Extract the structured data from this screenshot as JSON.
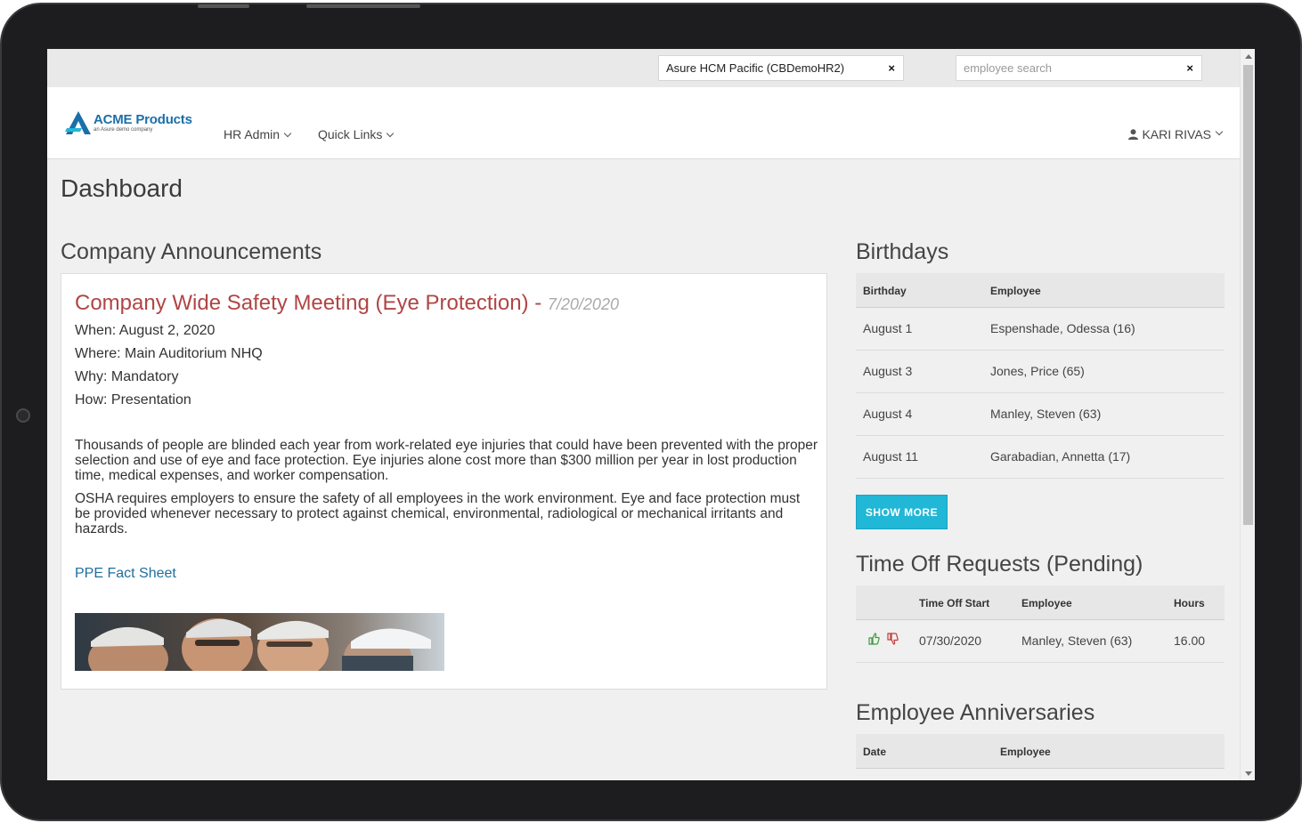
{
  "topbar": {
    "company_selector": "Asure HCM Pacific (CBDemoHR2)",
    "clear_symbol": "×",
    "search_placeholder": "employee search"
  },
  "navbar": {
    "logo_name": "ACME Products",
    "logo_sub": "an Asure demo company",
    "menu": [
      "HR Admin",
      "Quick Links"
    ],
    "user": "KARI RIVAS",
    "user_icon": "user-icon",
    "chevron_icon": "chevron-down-icon"
  },
  "page": {
    "title": "Dashboard"
  },
  "announcements": {
    "section_title": "Company Announcements",
    "title": "Company Wide Safety Meeting (Eye Protection)",
    "separator": " - ",
    "date": "7/20/2020",
    "lines": [
      "When:  August 2, 2020",
      "Where: Main Auditorium NHQ",
      "Why: Mandatory",
      "How: Presentation"
    ],
    "paragraphs": [
      "Thousands of people are blinded each year from work-related eye injuries that could have been prevented with the proper selection and use of eye and face protection. Eye injuries alone cost more than $300 million per year in lost production time, medical expenses, and worker compensation.",
      "OSHA requires employers to ensure the safety of all employees in the work environment. Eye and face protection must be provided whenever necessary to protect against chemical, environmental, radiological or mechanical irritants and hazards."
    ],
    "link": "PPE Fact Sheet"
  },
  "birthdays": {
    "section_title": "Birthdays",
    "headers": [
      "Birthday",
      "Employee"
    ],
    "rows": [
      [
        "August 1",
        "Espenshade, Odessa   (16)"
      ],
      [
        "August 3",
        "Jones, Price (65)"
      ],
      [
        "August 4",
        "Manley, Steven (63)"
      ],
      [
        "August 11",
        "Garabadian, Annetta   (17)"
      ]
    ],
    "show_more": "SHOW MORE"
  },
  "time_off": {
    "section_title": "Time Off Requests (Pending)",
    "headers": [
      "Time Off Start",
      "Employee",
      "Hours"
    ],
    "rows": [
      [
        "07/30/2020",
        "Manley, Steven (63)",
        "16.00"
      ]
    ],
    "approve_icon": "thumbs-up-icon",
    "deny_icon": "thumbs-down-icon"
  },
  "anniversaries": {
    "section_title": "Employee Anniversaries",
    "headers": [
      "Date",
      "Employee"
    ]
  },
  "colors": {
    "accent": "#21b7d6",
    "announcement_title": "#b04545",
    "link": "#1f6e9e",
    "brand": "#1b6fa8"
  }
}
